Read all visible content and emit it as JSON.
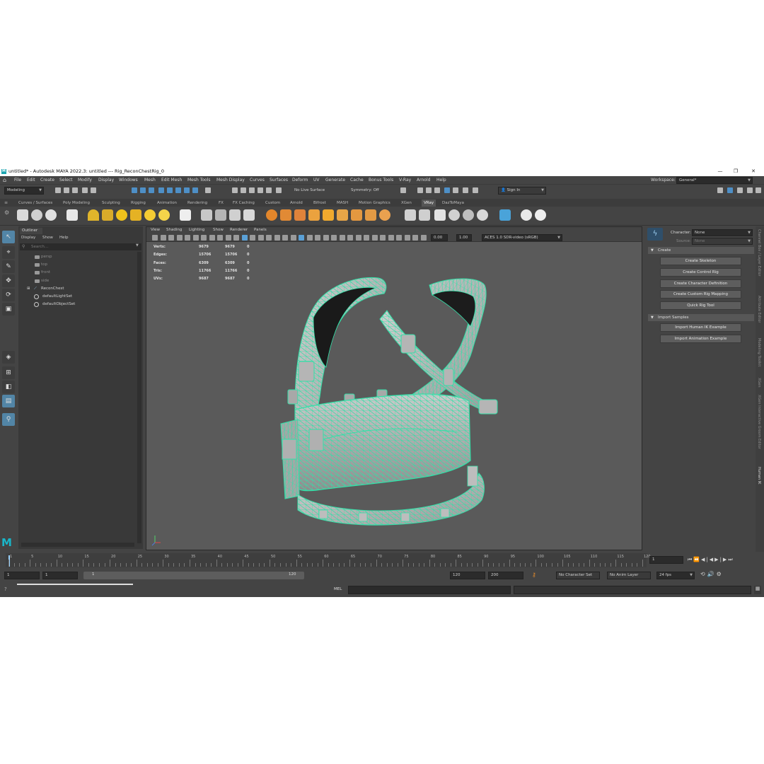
{
  "titlebar": {
    "title": "untitled* - Autodesk MAYA 2022.3: untitled   ---   Rig_ReconChestRig_0",
    "logo": "M",
    "minimize": "—",
    "maximize": "❐",
    "close": "✕"
  },
  "menubar": {
    "items": [
      "File",
      "Edit",
      "Create",
      "Select",
      "Modify",
      "Display",
      "Windows",
      "Mesh",
      "Edit Mesh",
      "Mesh Tools",
      "Mesh Display",
      "Curves",
      "Surfaces",
      "Deform",
      "UV",
      "Generate",
      "Cache",
      "Bonus Tools",
      "V-Ray",
      "Arnold",
      "Help"
    ],
    "workspace_label": "Workspace:",
    "workspace_value": "General*"
  },
  "statusline": {
    "mode": "Modeling",
    "live_surface": "No Live Surface",
    "symmetry": "Symmetry: Off",
    "sign_in": "Sign In"
  },
  "shelf": {
    "tabs": [
      "Curves / Surfaces",
      "Poly Modeling",
      "Sculpting",
      "Rigging",
      "Animation",
      "Rendering",
      "FX",
      "FX Caching",
      "Custom",
      "Arnold",
      "Bifrost",
      "MASH",
      "Motion Graphics",
      "XGen",
      "VRay",
      "DazToMaya"
    ],
    "active_tab": "VRay"
  },
  "outliner": {
    "tab": "Outliner",
    "menu": [
      "Display",
      "Show",
      "Help"
    ],
    "search_placeholder": "Search...",
    "items": [
      {
        "label": "persp",
        "dim": true
      },
      {
        "label": "top",
        "dim": true
      },
      {
        "label": "front",
        "dim": true
      },
      {
        "label": "side",
        "dim": true
      },
      {
        "label": "ReconChest",
        "dim": false
      },
      {
        "label": "defaultLightSet",
        "dim": false
      },
      {
        "label": "defaultObjectSet",
        "dim": false
      }
    ]
  },
  "viewport": {
    "menu": [
      "View",
      "Shading",
      "Lighting",
      "Show",
      "Renderer",
      "Panels"
    ],
    "exposure": "0.00",
    "gamma": "1.00",
    "colorspace": "ACES 1.0 SDR-video (sRGB)",
    "hud": [
      {
        "label": "Verts:",
        "a": "9679",
        "b": "9679",
        "c": "0"
      },
      {
        "label": "Edges:",
        "a": "15706",
        "b": "15706",
        "c": "0"
      },
      {
        "label": "Faces:",
        "a": "6309",
        "b": "6309",
        "c": "0"
      },
      {
        "label": "Tris:",
        "a": "11766",
        "b": "11766",
        "c": "0"
      },
      {
        "label": "UVs:",
        "a": "9687",
        "b": "9687",
        "c": "0"
      }
    ],
    "wire_color": "#33e0a8"
  },
  "humanik": {
    "character_label": "Character:",
    "character_value": "None",
    "source_label": "Source:",
    "source_value": "None",
    "create_section": "Create",
    "create_buttons": [
      "Create Skeleton",
      "Create Control Rig",
      "Create Character Definition",
      "Create Custom Rig Mapping",
      "Quick Rig Tool"
    ],
    "import_section": "Import Samples",
    "import_buttons": [
      "Import Human IK Example",
      "Import Animation Example"
    ]
  },
  "sidetabs": [
    "Channel Box / Layer Editor",
    "Attribute Editor",
    "Modeling Toolkit",
    "XGen",
    "XGen Interactive Groom Editor",
    "Human IK"
  ],
  "timeslider": {
    "ticks": [
      "1",
      "5",
      "10",
      "15",
      "20",
      "25",
      "30",
      "35",
      "40",
      "45",
      "50",
      "55",
      "60",
      "65",
      "70",
      "75",
      "80",
      "85",
      "90",
      "95",
      "100",
      "105",
      "110",
      "115",
      "120"
    ],
    "current_frame": "1"
  },
  "range": {
    "start": "1",
    "inner_start": "1",
    "slider_start": "1",
    "slider_end": "120",
    "end": "120",
    "anim_end": "200",
    "character_set": "No Character Set",
    "anim_layer": "No Anim Layer",
    "fps": "24 fps"
  },
  "cmdline": {
    "lang": "MEL"
  }
}
